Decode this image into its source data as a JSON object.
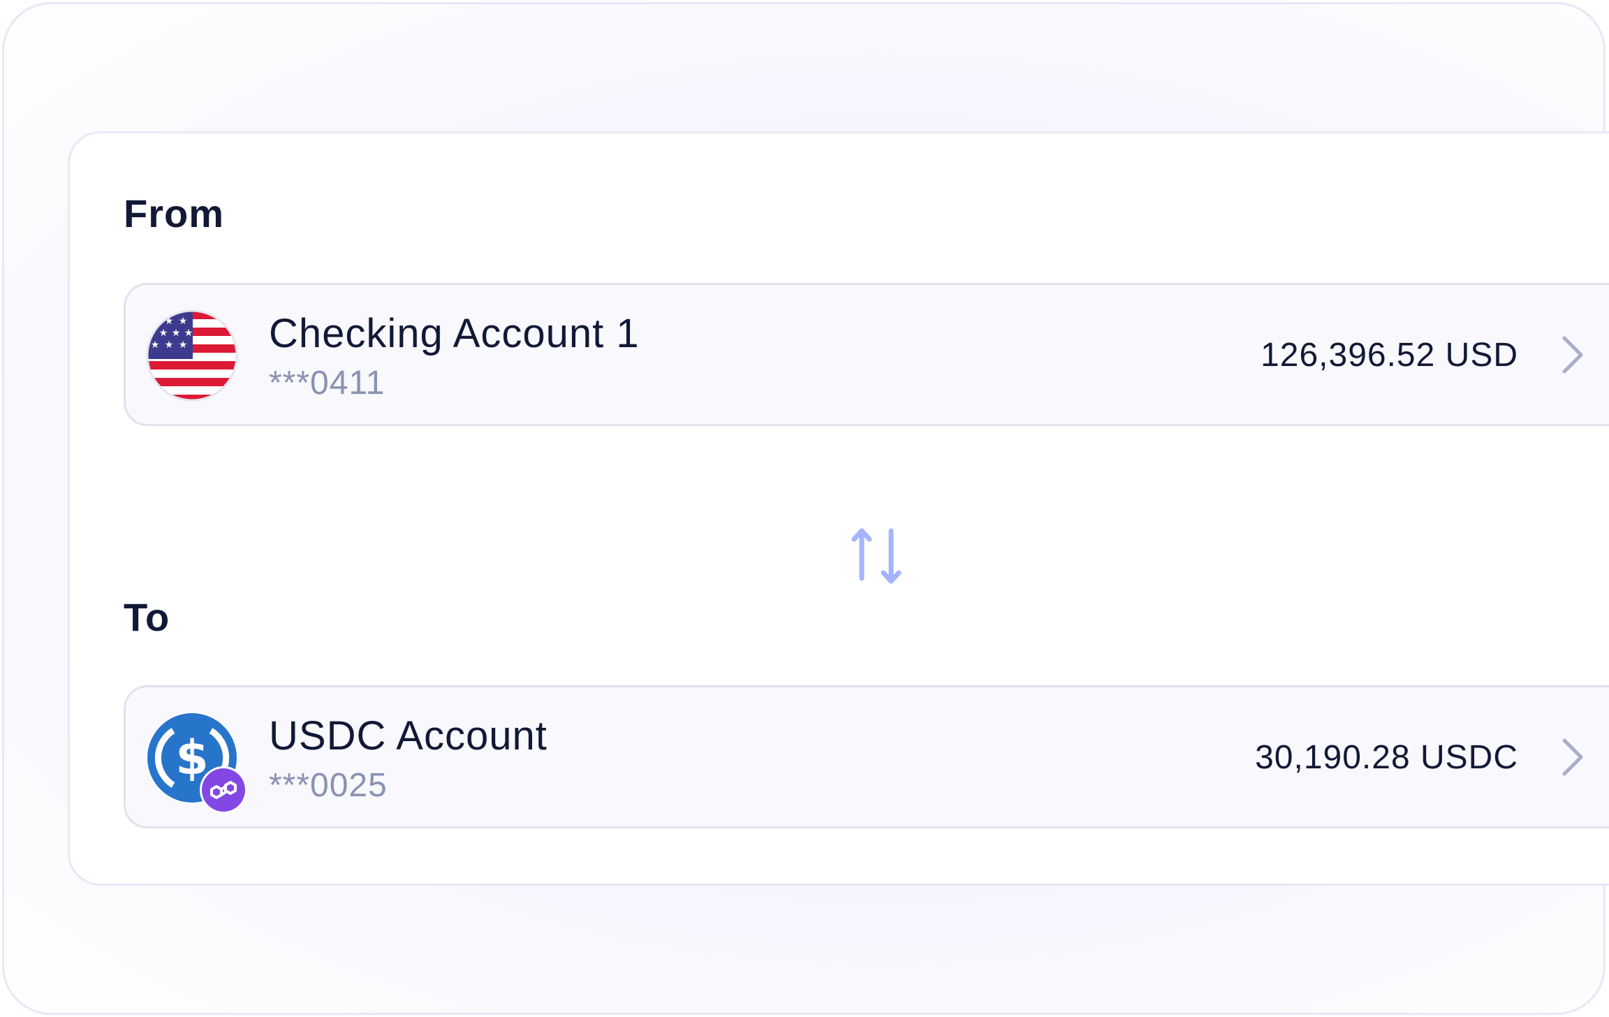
{
  "transfer": {
    "from_label": "From",
    "to_label": "To",
    "from_account": {
      "name": "Checking Account 1",
      "number": "***0411",
      "balance": "126,396.52 USD",
      "icon": "us-flag-icon"
    },
    "to_account": {
      "name": "USDC Account",
      "number": "***0025",
      "balance": "30,190.28 USDC",
      "icon": "usdc-icon",
      "network_badge_icon": "polygon-icon"
    },
    "swap_icon": "swap-arrows-icon"
  },
  "colors": {
    "text_primary": "#111936",
    "text_muted": "#8a92b2",
    "swap_accent": "#a5b4fc",
    "usdc_blue": "#2775ca",
    "polygon_purple": "#8247e5",
    "flag_red": "#dc1a36",
    "flag_blue": "#3c3b8e",
    "chevron": "#a8adc9"
  }
}
